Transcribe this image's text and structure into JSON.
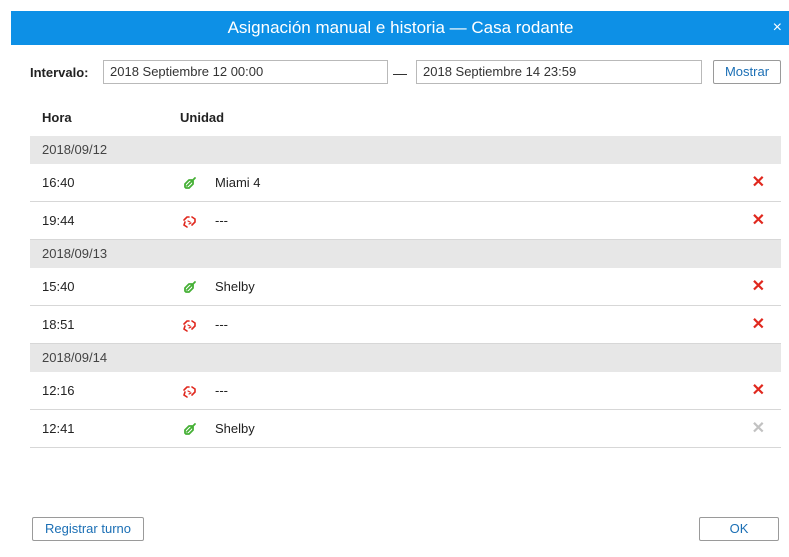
{
  "dialog": {
    "title": "Asignación manual e historia — Casa rodante",
    "close_glyph": "×"
  },
  "interval": {
    "label": "Intervalo:",
    "from": "2018 Septiembre 12 00:00",
    "separator": "—",
    "to": "2018 Septiembre 14 23:59",
    "show_button": "Mostrar"
  },
  "table": {
    "headers": {
      "time": "Hora",
      "unit": "Unidad"
    },
    "groups": [
      {
        "date": "2018/09/12",
        "rows": [
          {
            "time": "16:40",
            "icon": "link-icon",
            "unit": "Miami 4",
            "delete_enabled": true
          },
          {
            "time": "19:44",
            "icon": "unlink-icon",
            "unit": "---",
            "delete_enabled": true
          }
        ]
      },
      {
        "date": "2018/09/13",
        "rows": [
          {
            "time": "15:40",
            "icon": "link-icon",
            "unit": "Shelby",
            "delete_enabled": true
          },
          {
            "time": "18:51",
            "icon": "unlink-icon",
            "unit": "---",
            "delete_enabled": true
          }
        ]
      },
      {
        "date": "2018/09/14",
        "rows": [
          {
            "time": "12:16",
            "icon": "unlink-icon",
            "unit": "---",
            "delete_enabled": true
          },
          {
            "time": "12:41",
            "icon": "link-icon",
            "unit": "Shelby",
            "delete_enabled": false
          }
        ]
      }
    ],
    "delete_glyph": "✕"
  },
  "footer": {
    "register_button": "Registrar turno",
    "ok_button": "OK"
  },
  "colors": {
    "titlebar": "#0d90e6",
    "link_icon": "#45b035",
    "unlink_icon": "#e0281e",
    "delete_active": "#e0281e",
    "delete_disabled": "#c2c2c2"
  }
}
